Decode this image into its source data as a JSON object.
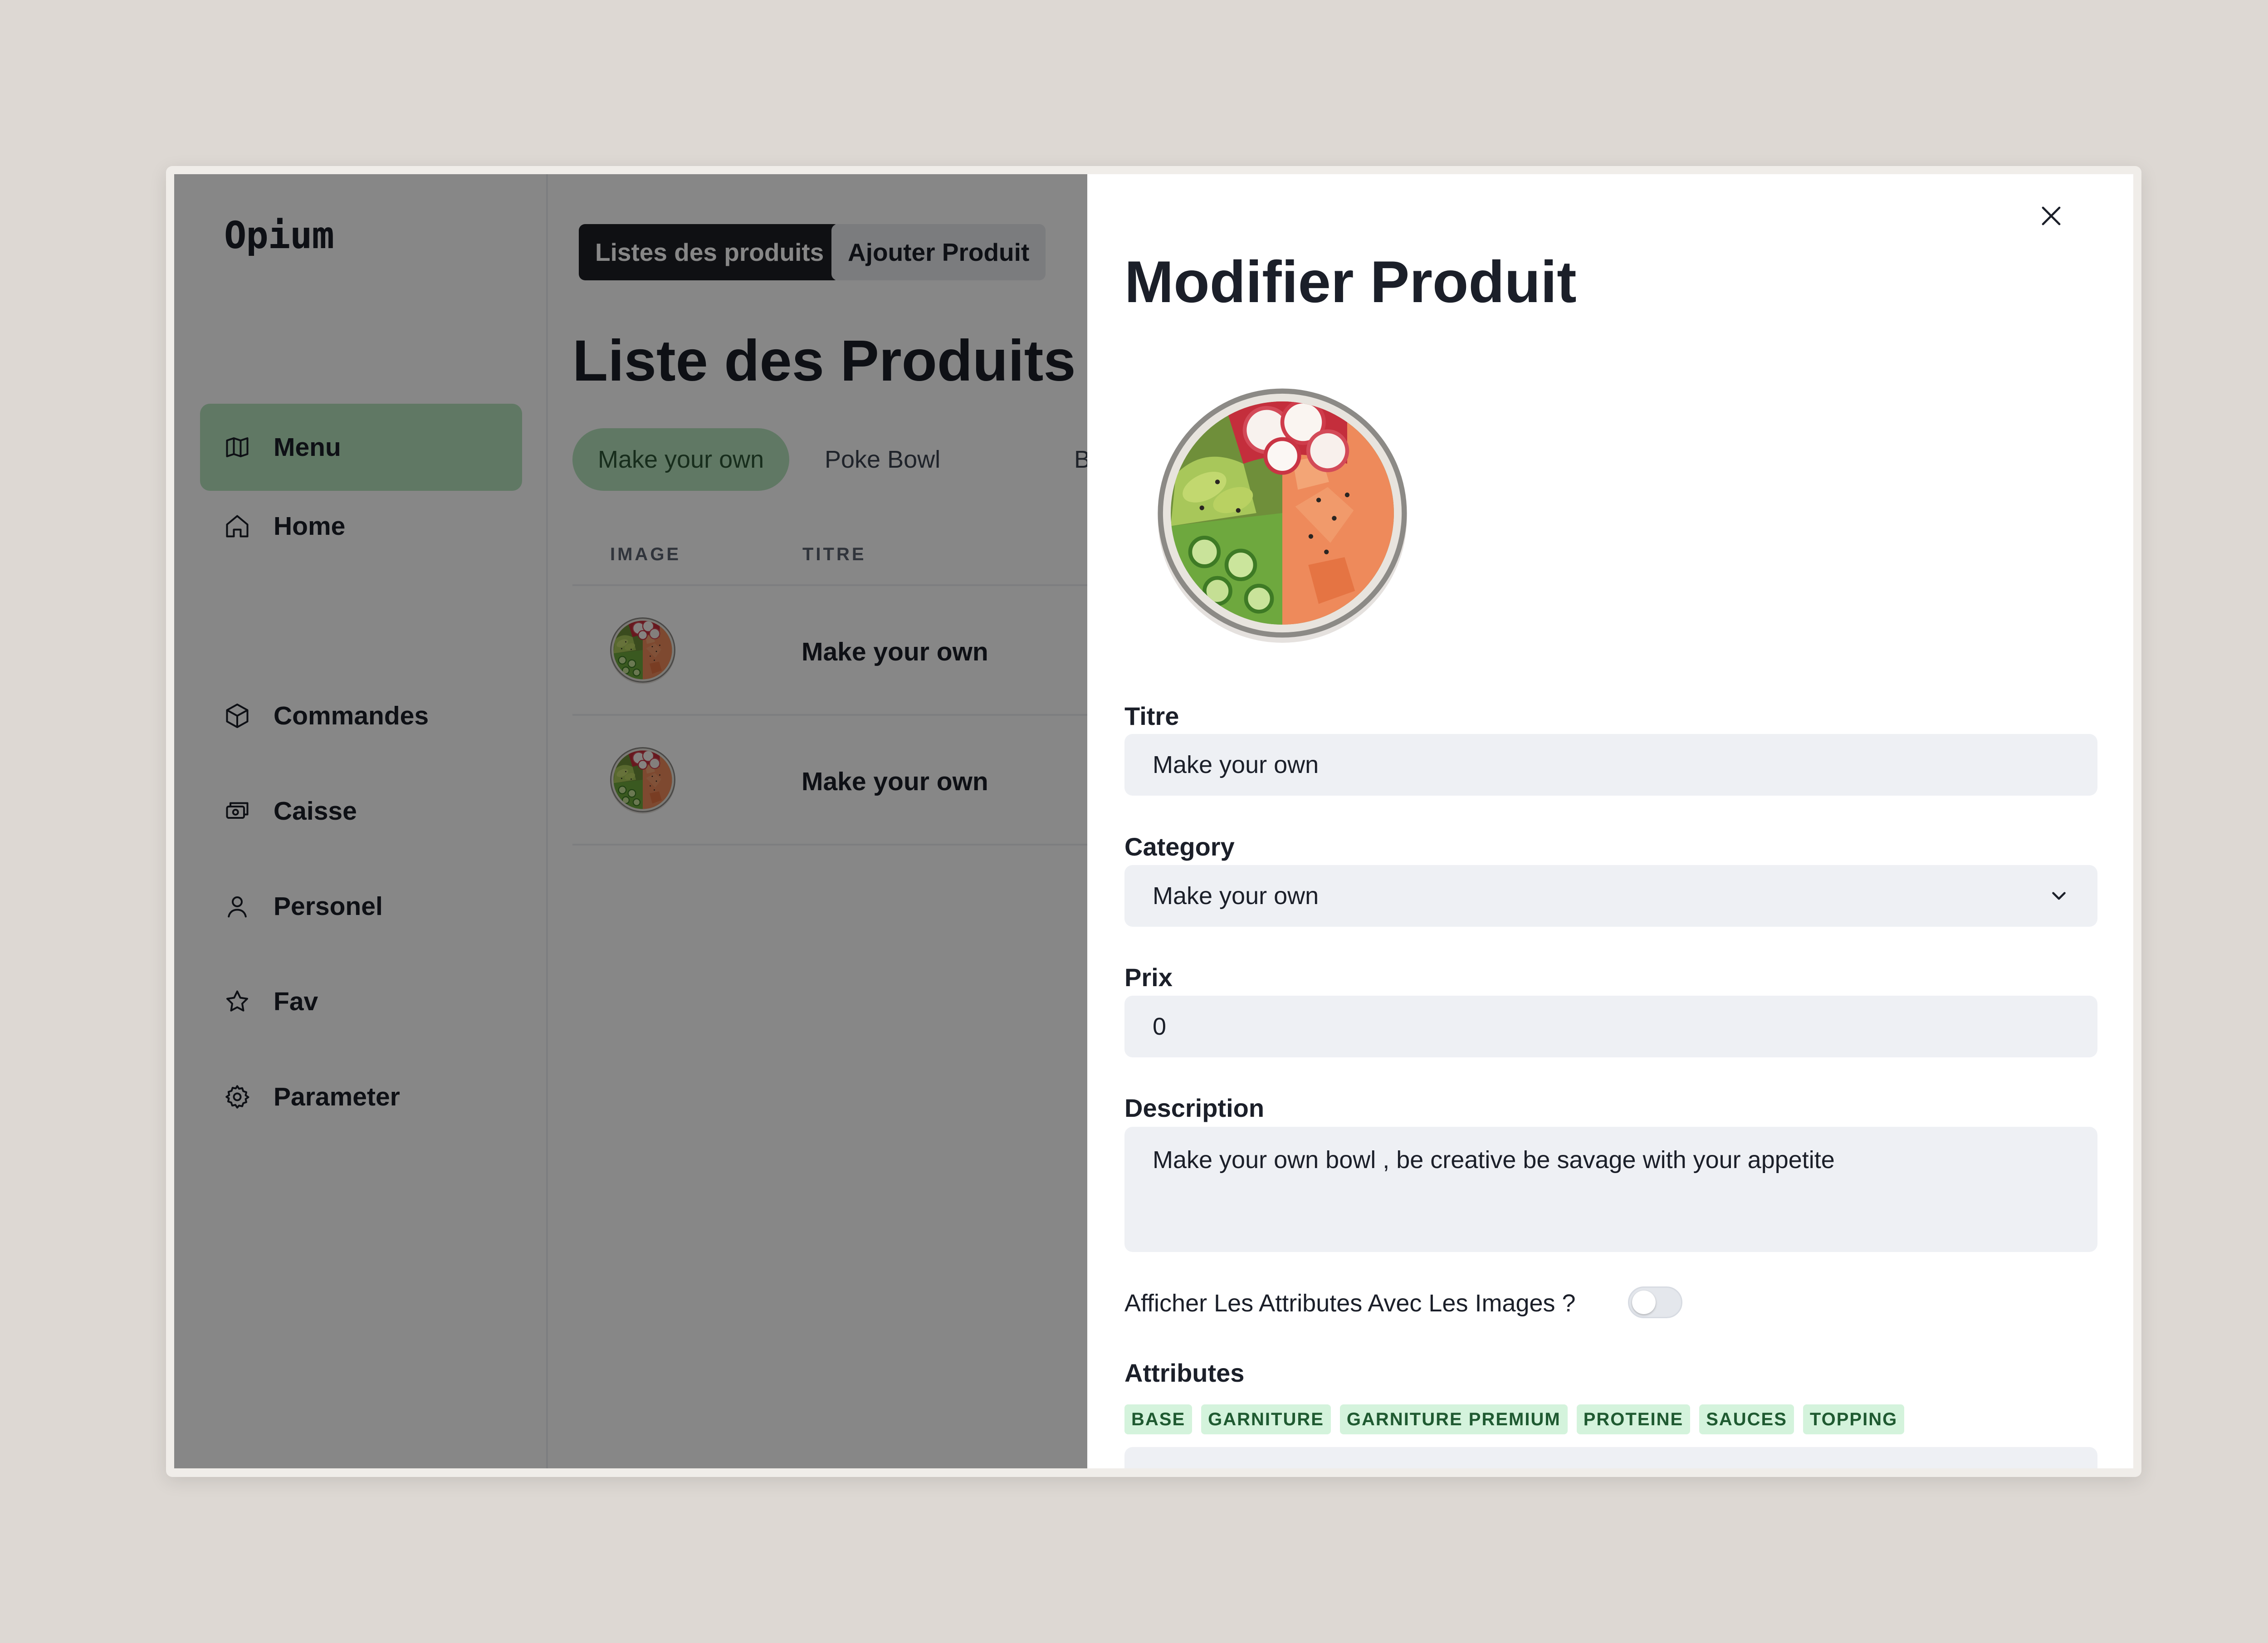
{
  "app": {
    "brand": "Opium"
  },
  "sidebar": {
    "items": [
      {
        "label": "Home",
        "icon": "home-icon",
        "active": false
      },
      {
        "label": "Menu",
        "icon": "map-icon",
        "active": true
      },
      {
        "label": "Commandes",
        "icon": "box-icon",
        "active": false
      },
      {
        "label": "Caisse",
        "icon": "cash-register-icon",
        "active": false
      },
      {
        "label": "Personel",
        "icon": "user-icon",
        "active": false
      },
      {
        "label": "Fav",
        "icon": "star-icon",
        "active": false
      },
      {
        "label": "Parameter",
        "icon": "gear-icon",
        "active": false
      }
    ]
  },
  "toolbar": {
    "list_label": "Listes des produits",
    "add_label": "Ajouter Produit"
  },
  "main": {
    "title": "Liste des Produits",
    "category_tabs": [
      {
        "label": "Make your own",
        "active": true
      },
      {
        "label": "Poke Bowl",
        "active": false
      },
      {
        "label": "Buddah",
        "active": false
      }
    ],
    "table": {
      "columns": [
        "IMAGE",
        "TITRE"
      ],
      "rows": [
        {
          "title": "Make your own"
        },
        {
          "title": "Make your own"
        }
      ]
    }
  },
  "drawer": {
    "title": "Modifier Produit",
    "close_icon": "close-icon",
    "fields": {
      "titre": {
        "label": "Titre",
        "value": "Make your own"
      },
      "category": {
        "label": "Category",
        "value": "Make your own"
      },
      "prix": {
        "label": "Prix",
        "value": "0"
      },
      "description": {
        "label": "Description",
        "value": "Make your own bowl , be creative be savage with your appetite"
      }
    },
    "toggle": {
      "label": "Afficher Les Attributes Avec Les Images ?",
      "on": false
    },
    "attributes": {
      "label": "Attributes",
      "tags": [
        "BASE",
        "GARNITURE",
        "GARNITURE PREMIUM",
        "PROTEINE",
        "SAUCES",
        "TOPPING"
      ]
    }
  },
  "colors": {
    "accent_green": "#b6e2bd",
    "tag_green": "#d4f3dc",
    "dark_button": "#1e1f24",
    "overlay": "rgba(0,0,0,0.47)"
  }
}
